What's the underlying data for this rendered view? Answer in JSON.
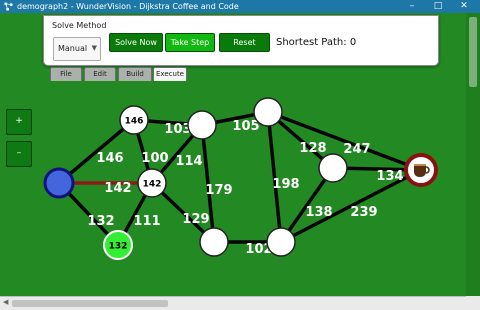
{
  "window": {
    "title": "demograph2 - WunderVision - Dijkstra Coffee and Code",
    "minimize": "–",
    "maximize": "□",
    "close": "✕"
  },
  "toolbar": {
    "solve_method_label": "Solve Method",
    "method_value": "Manual",
    "solve_now": "Solve Now",
    "take_step": "Take Step",
    "reset": "Reset",
    "shortest_path": "Shortest Path: 0"
  },
  "tabs": [
    "File",
    "Edit",
    "Build",
    "Execute"
  ],
  "zoom": {
    "in": "+",
    "out": "–"
  },
  "graph": {
    "nodes": [
      {
        "id": "n146",
        "label": "146",
        "type": "labeled"
      },
      {
        "id": "n142",
        "label": "142",
        "type": "labeled"
      },
      {
        "id": "n132",
        "label": "132",
        "type": "green"
      },
      {
        "id": "nstart",
        "label": "",
        "type": "start"
      },
      {
        "id": "nA",
        "label": "",
        "type": "plain"
      },
      {
        "id": "nB",
        "label": "",
        "type": "plain"
      },
      {
        "id": "nC",
        "label": "",
        "type": "plain"
      },
      {
        "id": "nD",
        "label": "",
        "type": "plain"
      },
      {
        "id": "nE",
        "label": "",
        "type": "plain"
      },
      {
        "id": "nend",
        "label": "",
        "type": "end"
      }
    ],
    "edges": [
      {
        "from": "nstart",
        "to": "n146",
        "weight": "146"
      },
      {
        "from": "nstart",
        "to": "n142",
        "weight": "142",
        "highlight": true
      },
      {
        "from": "nstart",
        "to": "n132",
        "weight": "132"
      },
      {
        "from": "n146",
        "to": "n142",
        "weight": "100"
      },
      {
        "from": "n146",
        "to": "nA",
        "weight": "103"
      },
      {
        "from": "n142",
        "to": "nA",
        "weight": "114"
      },
      {
        "from": "n142",
        "to": "n132",
        "weight": "111"
      },
      {
        "from": "n142",
        "to": "nD",
        "weight": "129"
      },
      {
        "from": "nA",
        "to": "nB",
        "weight": "105"
      },
      {
        "from": "nA",
        "to": "nD",
        "weight": "179"
      },
      {
        "from": "nB",
        "to": "nC",
        "weight": "128"
      },
      {
        "from": "nB",
        "to": "nE",
        "weight": "198"
      },
      {
        "from": "nB",
        "to": "nend",
        "weight": "247"
      },
      {
        "from": "nC",
        "to": "nend",
        "weight": "134"
      },
      {
        "from": "nC",
        "to": "nE",
        "weight": "138"
      },
      {
        "from": "nE",
        "to": "nend",
        "weight": "239"
      },
      {
        "from": "nD",
        "to": "nE",
        "weight": "102"
      }
    ]
  },
  "colors": {
    "background": "#238a23",
    "titlebar": "#1d78a8",
    "edge": "#050505",
    "highlight_edge": "#8b1a1a",
    "start_fill": "#4466dd",
    "end_ring": "#8b1010",
    "green_node": "#33ee33"
  }
}
